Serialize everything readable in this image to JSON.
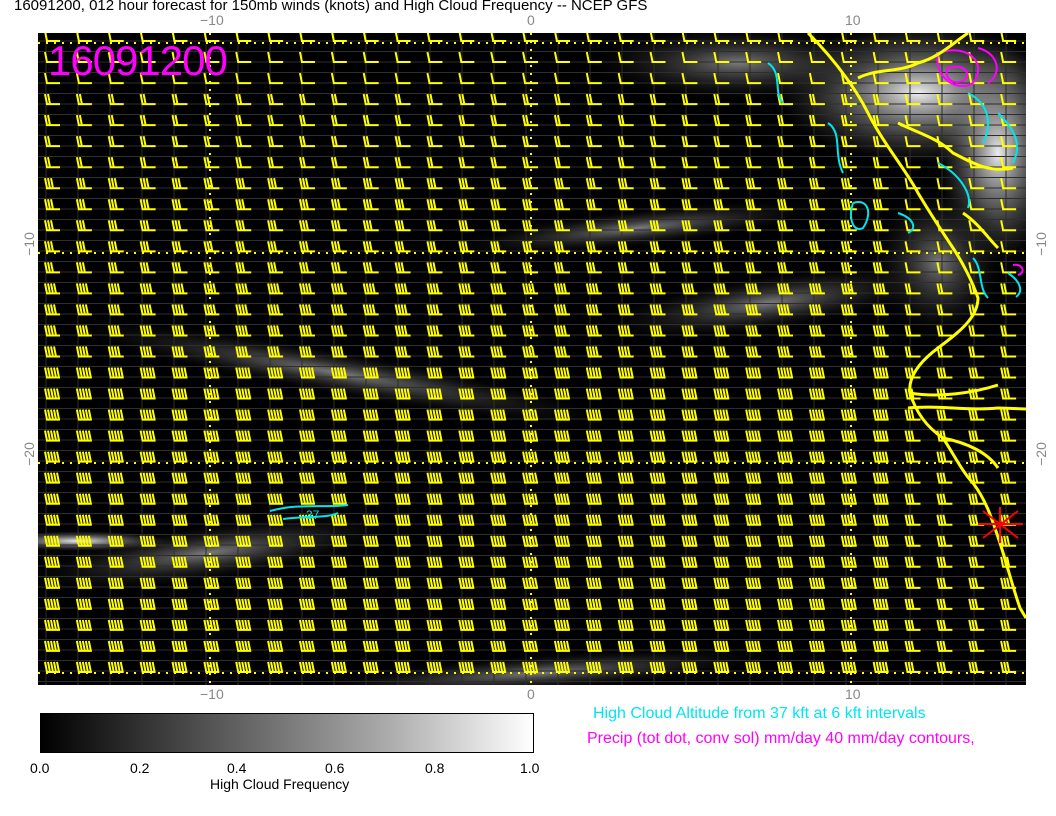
{
  "title": "16091200, 012 hour forecast for 150mb winds (knots) and High Cloud Frequency -- NCEP GFS",
  "stamp": "16091200",
  "axes": {
    "x_ticks_top": [
      "−10",
      "0",
      "10"
    ],
    "x_ticks_bottom": [
      "−10",
      "0",
      "10"
    ],
    "y_ticks_left": [
      "−10",
      "−20"
    ],
    "y_ticks_right": [
      "−10",
      "−20"
    ]
  },
  "contour_label": "37",
  "colorbar": {
    "ticks": [
      "0.0",
      "0.2",
      "0.4",
      "0.6",
      "0.8",
      "1.0"
    ],
    "label": "High Cloud Frequency"
  },
  "legend": {
    "cyan": "High Cloud Altitude from 37 kft at 6 kft intervals",
    "magenta": "Precip (tot dot, conv sol) mm/day 40 mm/day contours,"
  },
  "colors": {
    "wind_barb": "#ffff00",
    "coastline": "#ffff00",
    "cloud_altitude": "#00e5ee",
    "precip": "#ff00ff",
    "marker": "#ff0000"
  }
}
